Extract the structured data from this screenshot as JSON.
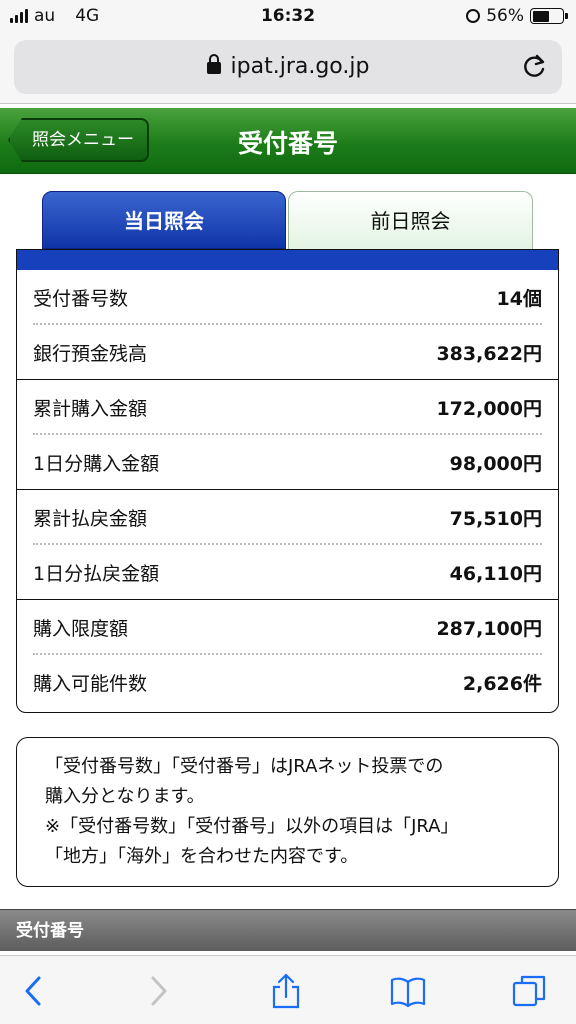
{
  "status_bar": {
    "carrier": "au",
    "network": "4G",
    "time": "16:32",
    "battery": "56%"
  },
  "browser": {
    "url": "ipat.jra.go.jp"
  },
  "header": {
    "back_label": "照会メニュー",
    "title": "受付番号"
  },
  "tabs": [
    {
      "label": "当日照会",
      "active": true
    },
    {
      "label": "前日照会",
      "active": false
    }
  ],
  "summary": [
    {
      "label": "受付番号数",
      "value": "14個"
    },
    {
      "label": "銀行預金残高",
      "value": "383,622円"
    },
    {
      "label": "累計購入金額",
      "value": "172,000円"
    },
    {
      "label": "1日分購入金額",
      "value": "98,000円"
    },
    {
      "label": "累計払戻金額",
      "value": "75,510円"
    },
    {
      "label": "1日分払戻金額",
      "value": "46,110円"
    },
    {
      "label": "購入限度額",
      "value": "287,100円"
    },
    {
      "label": "購入可能件数",
      "value": "2,626件"
    }
  ],
  "note": {
    "line1": "「受付番号数」「受付番号」はJRAネット投票での",
    "line2": "購入分となります。",
    "line3": "※「受付番号数」「受付番号」以外の項目は「JRA」",
    "line4": "「地方」「海外」を合わせた内容です。"
  },
  "section_title": "受付番号",
  "colors": {
    "header_green": "#1d7d1a",
    "tab_blue": "#1740bd"
  }
}
